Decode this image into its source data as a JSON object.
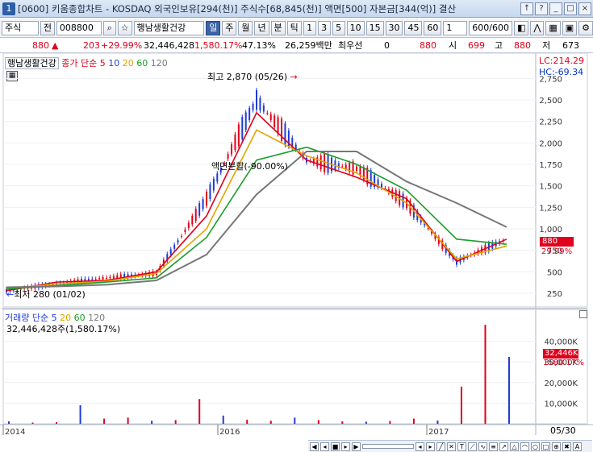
{
  "window": {
    "number": "1",
    "title": "[0600] 키움종합차트 - KOSDAQ 외국인보유[294(천)] 주식수[68,845(천)] 액면[500] 자본금[344(억)] 결산",
    "buttons": [
      "↑",
      "?",
      "_",
      "□",
      "×"
    ]
  },
  "toolbar": {
    "market": "주식",
    "prev_label": "전",
    "code": "008800",
    "name": "행남생활건강",
    "periods": [
      "일",
      "주",
      "월",
      "년",
      "분",
      "틱"
    ],
    "active_period": "일",
    "minutes": [
      "1",
      "3",
      "5",
      "10",
      "15",
      "30",
      "45",
      "60"
    ],
    "unit": "1",
    "count": "600/600"
  },
  "quote": {
    "price": "880",
    "change": "203",
    "change_pct": "+29.99%",
    "volume": "32,446,428",
    "vol_ratio": "1,580.17%",
    "turnover": "47.13%",
    "amount": "26,259백만",
    "pref_label": "최우선",
    "pref_value": "0",
    "ask": "880",
    "open_label": "시",
    "open": "699",
    "high_label": "고",
    "high": "880",
    "low_label": "저",
    "low": "673"
  },
  "price_panel": {
    "stock_name": "행남생활건강",
    "legend": {
      "label": "종가 단순",
      "periods": [
        "5",
        "10",
        "20",
        "60",
        "120"
      ],
      "colors": [
        "#e0001b",
        "#1f3bd6",
        "#e3a400",
        "#1a9e2c",
        "#777777"
      ]
    },
    "lc": "LC:214.29",
    "hc": "HC:-69.34",
    "high_note": "최고 2,870 (05/26)",
    "low_note": "최저 280 (01/02)",
    "split_note": "액면분할(-90.00%)",
    "last_price": "880",
    "last_pct": "29.99%"
  },
  "volume_panel": {
    "legend_label": "거래량 단순",
    "periods": [
      "5",
      "20",
      "60",
      "120"
    ],
    "colors": [
      "#1f3bd6",
      "#e3a400",
      "#1a9e2c",
      "#777777"
    ],
    "current": "32,446,428주(1,580.17%)",
    "last_value": "32,446K",
    "last_pct": "1580.17%"
  },
  "chart_data": [
    {
      "type": "line",
      "title": "행남생활건강",
      "x": [
        "2014",
        "2016",
        "2017"
      ],
      "ylim": [
        100,
        2800
      ],
      "yticks": [
        "250",
        "500",
        "750",
        "1,000",
        "1,250",
        "1,500",
        "1,750",
        "2,000",
        "2,250",
        "2,500",
        "2,750"
      ],
      "series": [
        {
          "name": "5",
          "values": [
            280,
            380,
            400,
            500,
            1150,
            2350,
            1800,
            1600,
            1350,
            620,
            880
          ]
        },
        {
          "name": "20",
          "values": [
            300,
            360,
            390,
            480,
            1000,
            2150,
            1850,
            1650,
            1300,
            650,
            800
          ]
        },
        {
          "name": "60",
          "values": [
            300,
            340,
            380,
            430,
            900,
            1800,
            1950,
            1750,
            1450,
            880,
            820
          ]
        },
        {
          "name": "120",
          "values": [
            320,
            330,
            350,
            400,
            700,
            1400,
            1900,
            1900,
            1550,
            1300,
            1020
          ]
        }
      ],
      "close": [
        280,
        360,
        430,
        480,
        1350,
        2500,
        1800,
        1700,
        1300,
        620,
        880
      ],
      "xlabel": "",
      "ylabel": ""
    },
    {
      "type": "bar",
      "title": "거래량",
      "ylim": [
        0,
        50000
      ],
      "yticks": [
        "10,000K",
        "20,000K",
        "30,000K",
        "40,000K"
      ],
      "values": [
        1200,
        600,
        800,
        9000,
        2500,
        3000,
        1500,
        1800,
        12000,
        4000,
        2000,
        1500,
        3000,
        1800,
        1200,
        1000,
        1400,
        2500,
        1600,
        18000,
        48000,
        32446
      ],
      "xlabel": "",
      "ylabel": ""
    }
  ],
  "xaxis": {
    "labels": [
      "2014",
      "2016",
      "2017"
    ],
    "date": "05/30"
  }
}
